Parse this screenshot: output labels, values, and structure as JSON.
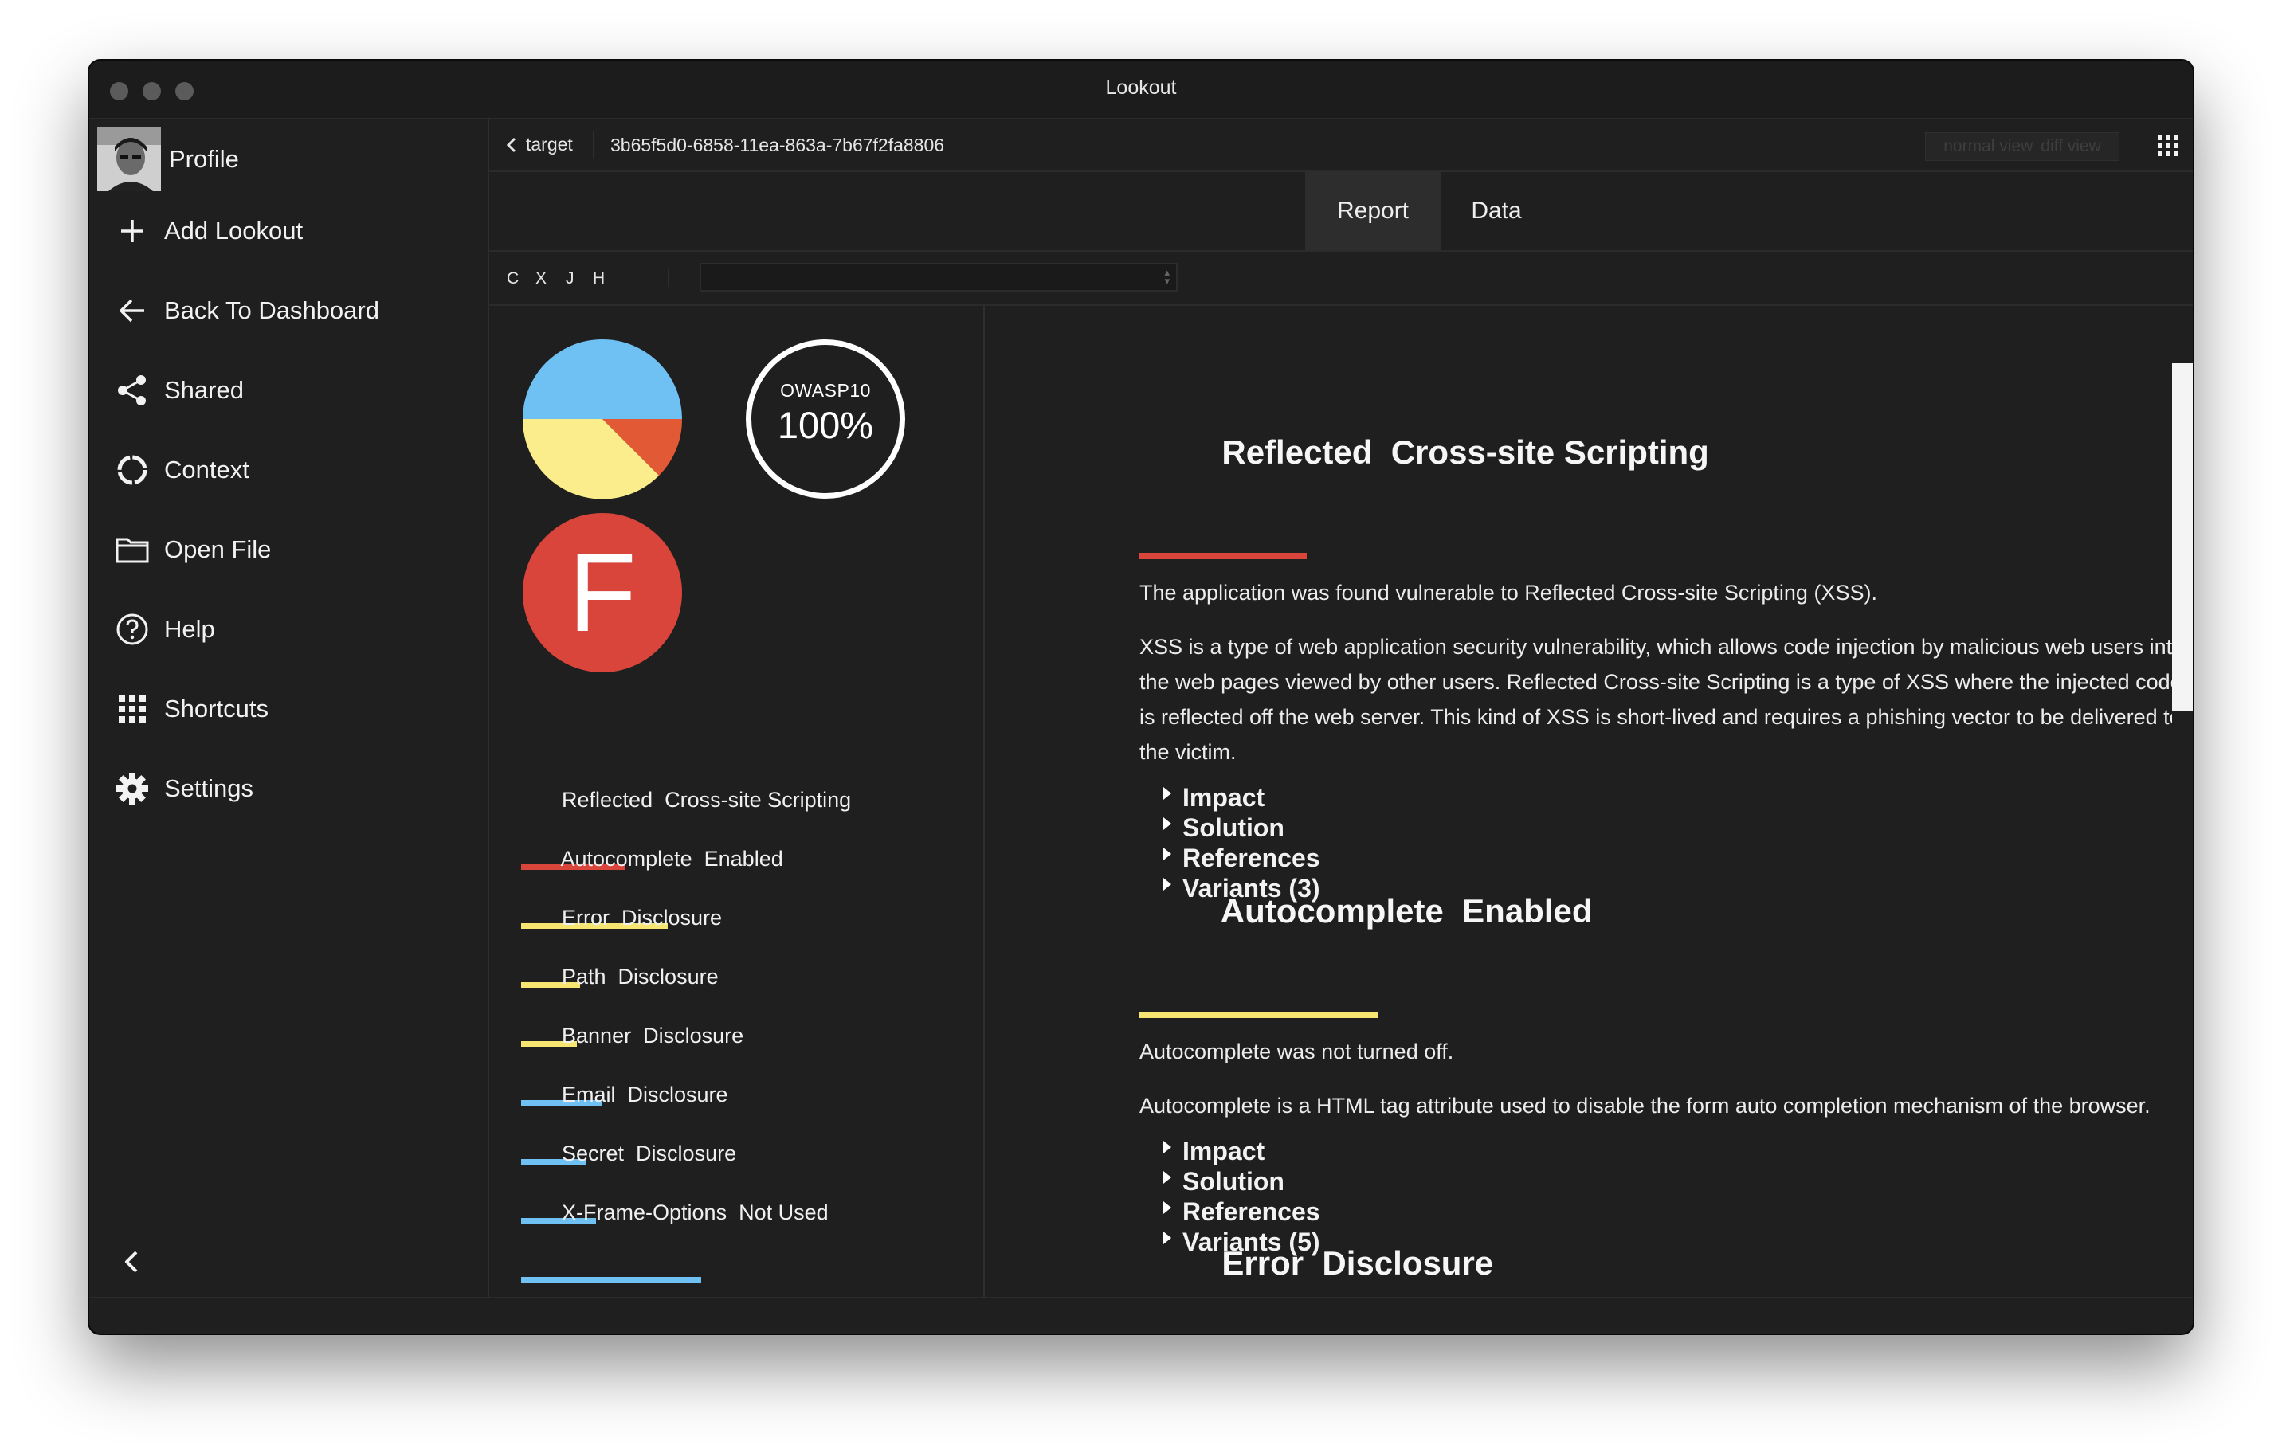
{
  "window": {
    "title": "Lookout"
  },
  "sidebar": {
    "profile_label": "Profile",
    "items": [
      {
        "label": "Add Lookout",
        "icon": "plus-icon"
      },
      {
        "label": "Back To Dashboard",
        "icon": "arrow-left-icon"
      },
      {
        "label": "Shared",
        "icon": "share-icon"
      },
      {
        "label": "Context",
        "icon": "context-ring-icon"
      },
      {
        "label": "Open File",
        "icon": "folder-icon"
      },
      {
        "label": "Help",
        "icon": "help-icon"
      },
      {
        "label": "Shortcuts",
        "icon": "grid-icon"
      },
      {
        "label": "Settings",
        "icon": "gear-icon"
      }
    ]
  },
  "topbar": {
    "back_label": "target",
    "target_id": "3b65f5d0-6858-11ea-863a-7b67f2fa8806",
    "view_options": [
      "normal view",
      "diff view"
    ]
  },
  "tabs": [
    {
      "label": "Report",
      "active": true
    },
    {
      "label": "Data",
      "active": false
    }
  ],
  "filters": {
    "c": "C",
    "x": "X",
    "j": "J",
    "h": "H",
    "search_value": ""
  },
  "summary": {
    "pie_colors": [
      "#6ec1f2",
      "#fbec8c",
      "#e25a35"
    ],
    "owasp_label": "OWASP10",
    "owasp_value": "100%",
    "grade": "F",
    "issues": [
      {
        "name": "Reflected  Cross-site Scripting",
        "color": "#d9443b"
      },
      {
        "name": "Autocomplete  Enabled",
        "color": "#f6e671"
      },
      {
        "name": "Error  Disclosure",
        "color": "#f6e671"
      },
      {
        "name": "Path  Disclosure",
        "color": "#f6e671"
      },
      {
        "name": "Banner  Disclosure",
        "color": "#6ec1f2"
      },
      {
        "name": "Email  Disclosure",
        "color": "#6ec1f2"
      },
      {
        "name": "Secret  Disclosure",
        "color": "#6ec1f2"
      },
      {
        "name": "X-Frame-Options  Not Used",
        "color": "#6ec1f2"
      }
    ]
  },
  "report": {
    "sections": [
      {
        "title": "Reflected  Cross-site Scripting",
        "color": "#d9443b",
        "summary": "The application was found vulnerable to Reflected Cross-site Scripting (XSS).",
        "description": "XSS is a type of web application security vulnerability, which allows code injection by malicious web users into the web pages viewed by other users. Reflected Cross-site Scripting is a type of XSS where the injected code is reflected off the web server. This kind of XSS is short-lived and requires a phishing vector to be delivered to the victim.",
        "details": [
          "Impact",
          "Solution",
          "References",
          "Variants (3)"
        ]
      },
      {
        "title": "Autocomplete  Enabled",
        "color": "#f6e671",
        "summary": "Autocomplete was not turned off.",
        "description": "Autocomplete is a HTML tag attribute used to disable the form auto completion mechanism of the browser.",
        "details": [
          "Impact",
          "Solution",
          "References",
          "Variants (5)"
        ]
      },
      {
        "title": "Error  Disclosure",
        "color": "#f6e671"
      }
    ]
  }
}
